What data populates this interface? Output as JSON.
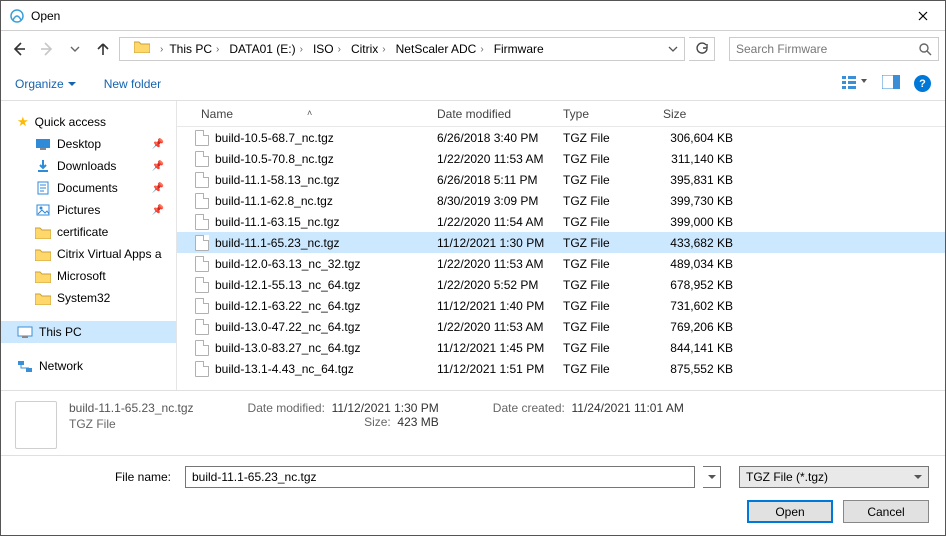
{
  "titlebar": {
    "title": "Open"
  },
  "breadcrumb": [
    "This PC",
    "DATA01 (E:)",
    "ISO",
    "Citrix",
    "NetScaler ADC",
    "Firmware"
  ],
  "search": {
    "placeholder": "Search Firmware"
  },
  "toolbar": {
    "organize": "Organize",
    "new_folder": "New folder"
  },
  "sidebar": {
    "quick_access": "Quick access",
    "pinned": [
      {
        "label": "Desktop",
        "icon": "desktop"
      },
      {
        "label": "Downloads",
        "icon": "downloads"
      },
      {
        "label": "Documents",
        "icon": "documents"
      },
      {
        "label": "Pictures",
        "icon": "pictures"
      }
    ],
    "folders": [
      "certificate",
      "Citrix Virtual Apps a",
      "Microsoft",
      "System32"
    ],
    "this_pc": "This PC",
    "network": "Network"
  },
  "columns": {
    "name": "Name",
    "date": "Date modified",
    "type": "Type",
    "size": "Size"
  },
  "files": [
    {
      "name": "build-10.5-68.7_nc.tgz",
      "date": "6/26/2018 3:40 PM",
      "type": "TGZ File",
      "size": "306,604 KB",
      "selected": false
    },
    {
      "name": "build-10.5-70.8_nc.tgz",
      "date": "1/22/2020 11:53 AM",
      "type": "TGZ File",
      "size": "311,140 KB",
      "selected": false
    },
    {
      "name": "build-11.1-58.13_nc.tgz",
      "date": "6/26/2018 5:11 PM",
      "type": "TGZ File",
      "size": "395,831 KB",
      "selected": false
    },
    {
      "name": "build-11.1-62.8_nc.tgz",
      "date": "8/30/2019 3:09 PM",
      "type": "TGZ File",
      "size": "399,730 KB",
      "selected": false
    },
    {
      "name": "build-11.1-63.15_nc.tgz",
      "date": "1/22/2020 11:54 AM",
      "type": "TGZ File",
      "size": "399,000 KB",
      "selected": false
    },
    {
      "name": "build-11.1-65.23_nc.tgz",
      "date": "11/12/2021 1:30 PM",
      "type": "TGZ File",
      "size": "433,682 KB",
      "selected": true
    },
    {
      "name": "build-12.0-63.13_nc_32.tgz",
      "date": "1/22/2020 11:53 AM",
      "type": "TGZ File",
      "size": "489,034 KB",
      "selected": false
    },
    {
      "name": "build-12.1-55.13_nc_64.tgz",
      "date": "1/22/2020 5:52 PM",
      "type": "TGZ File",
      "size": "678,952 KB",
      "selected": false
    },
    {
      "name": "build-12.1-63.22_nc_64.tgz",
      "date": "11/12/2021 1:40 PM",
      "type": "TGZ File",
      "size": "731,602 KB",
      "selected": false
    },
    {
      "name": "build-13.0-47.22_nc_64.tgz",
      "date": "1/22/2020 11:53 AM",
      "type": "TGZ File",
      "size": "769,206 KB",
      "selected": false
    },
    {
      "name": "build-13.0-83.27_nc_64.tgz",
      "date": "11/12/2021 1:45 PM",
      "type": "TGZ File",
      "size": "844,141 KB",
      "selected": false
    },
    {
      "name": "build-13.1-4.43_nc_64.tgz",
      "date": "11/12/2021 1:51 PM",
      "type": "TGZ File",
      "size": "875,552 KB",
      "selected": false
    }
  ],
  "details": {
    "name": "build-11.1-65.23_nc.tgz",
    "type": "TGZ File",
    "date_modified_label": "Date modified:",
    "date_modified": "11/12/2021 1:30 PM",
    "size_label": "Size:",
    "size": "423 MB",
    "date_created_label": "Date created:",
    "date_created": "11/24/2021 11:01 AM"
  },
  "footer": {
    "file_name_label": "File name:",
    "file_name_value": "build-11.1-65.23_nc.tgz",
    "filter": "TGZ File (*.tgz)",
    "open": "Open",
    "cancel": "Cancel"
  }
}
